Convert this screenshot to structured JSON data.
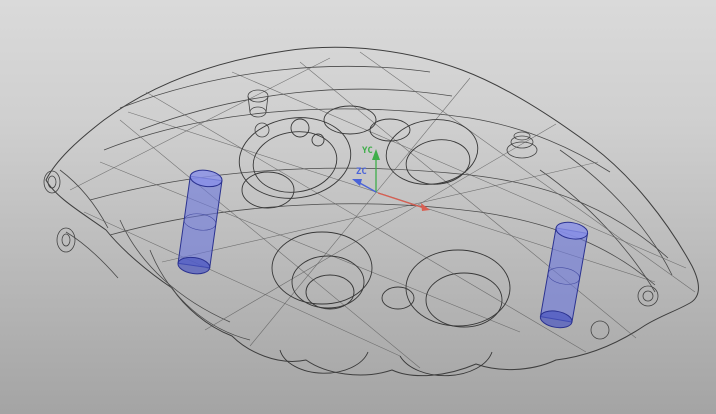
{
  "viewport": {
    "description": "3D CAD viewport showing a translucent wireframe brake caliper model on a gray gradient background",
    "render_style": "translucent shaded with visible edges",
    "background_top": "#dadada",
    "background_bottom": "#a4a4a4"
  },
  "model": {
    "part": "brake caliper",
    "body_fill": "#e8ede9",
    "edge_color": "#3e3e3e",
    "pistons": {
      "count_visible": 2,
      "fill": "#6b77dd",
      "edge": "#2b3290",
      "cap_fill": "#8890e8",
      "base_fill": "#4a55c0"
    }
  },
  "csys": {
    "labels": {
      "yc": "YC",
      "zc": "ZC"
    },
    "axis_colors": {
      "x": "#d95f52",
      "y": "#3fae4a",
      "z": "#4a63d8"
    }
  }
}
